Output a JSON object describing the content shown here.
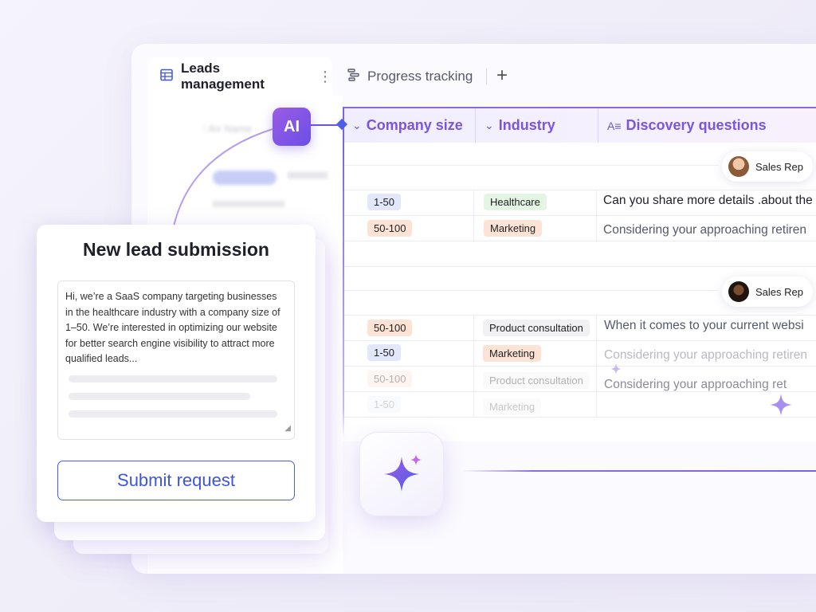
{
  "tabs": {
    "active": {
      "label": "Leads management",
      "icon": "table-icon"
    },
    "second": {
      "label": "Progress tracking",
      "icon": "timeline-icon"
    },
    "add_label": "+"
  },
  "ai_badge": "AI",
  "table": {
    "columns": [
      {
        "label": "Company size",
        "icon": "single-select-icon"
      },
      {
        "label": "Industry",
        "icon": "single-select-icon"
      },
      {
        "label": "Discovery questions",
        "icon": "ai-text-icon"
      }
    ],
    "groups": [
      {
        "assignee": "Sales Rep",
        "rows": [
          {
            "size": "1-50",
            "industry": "Healthcare",
            "question": "Can you share more details .about the"
          },
          {
            "size": "50-100",
            "industry": "Marketing",
            "question": "Considering your approaching retiren"
          }
        ]
      },
      {
        "assignee": "Sales Rep",
        "rows": [
          {
            "size": "50-100",
            "industry": "Product consultation",
            "question": "When it comes to your current websi"
          },
          {
            "size": "1-50",
            "industry": "Marketing",
            "question": "Considering your approaching retiren"
          },
          {
            "size": "50-100",
            "industry": "Product consultation",
            "question": "Considering your approaching reti"
          },
          {
            "size": "1-50",
            "industry": "Marketing",
            "question": ""
          }
        ]
      }
    ]
  },
  "form": {
    "title": "New lead submission",
    "message": "Hi, we’re a SaaS company targeting businesses in the healthcare industry with a company size of 1–50. We’re interested in optimizing our website for better search engine visibility to attract more qualified leads...",
    "submit_label": "Submit request"
  },
  "colors": {
    "accent_purple": "#7a55e0",
    "accent_blue": "#3f55d8",
    "tag_blue": "#e3e7fb",
    "tag_orange": "#fde3d6",
    "tag_green": "#e2f6e3"
  }
}
